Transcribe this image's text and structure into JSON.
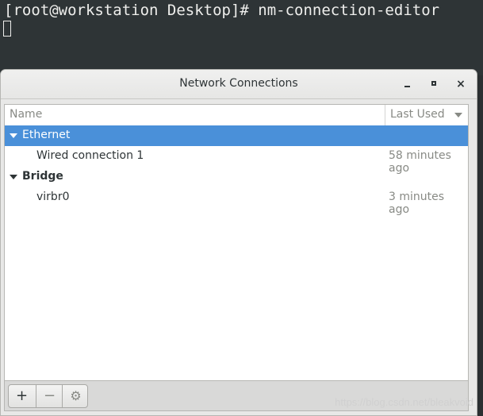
{
  "terminal": {
    "prompt_line": "[root@workstation Desktop]# nm-connection-editor"
  },
  "window": {
    "title": "Network Connections",
    "controls": {
      "minimize": "minimize",
      "maximize": "maximize",
      "close": "×"
    }
  },
  "table": {
    "columns": {
      "name": "Name",
      "last_used": "Last Used"
    },
    "groups": [
      {
        "label": "Ethernet",
        "selected": true,
        "items": [
          {
            "name": "Wired connection 1",
            "last_used": "58 minutes ago"
          }
        ]
      },
      {
        "label": "Bridge",
        "selected": false,
        "items": [
          {
            "name": "virbr0",
            "last_used": "3 minutes ago"
          }
        ]
      }
    ]
  },
  "toolbar": {
    "add": "+",
    "remove": "−",
    "settings": "⚙"
  },
  "watermark": "https://blog.csdn.net/bleakvoid",
  "colors": {
    "selection": "#4a90d9",
    "terminal_bg": "#2e3436"
  }
}
